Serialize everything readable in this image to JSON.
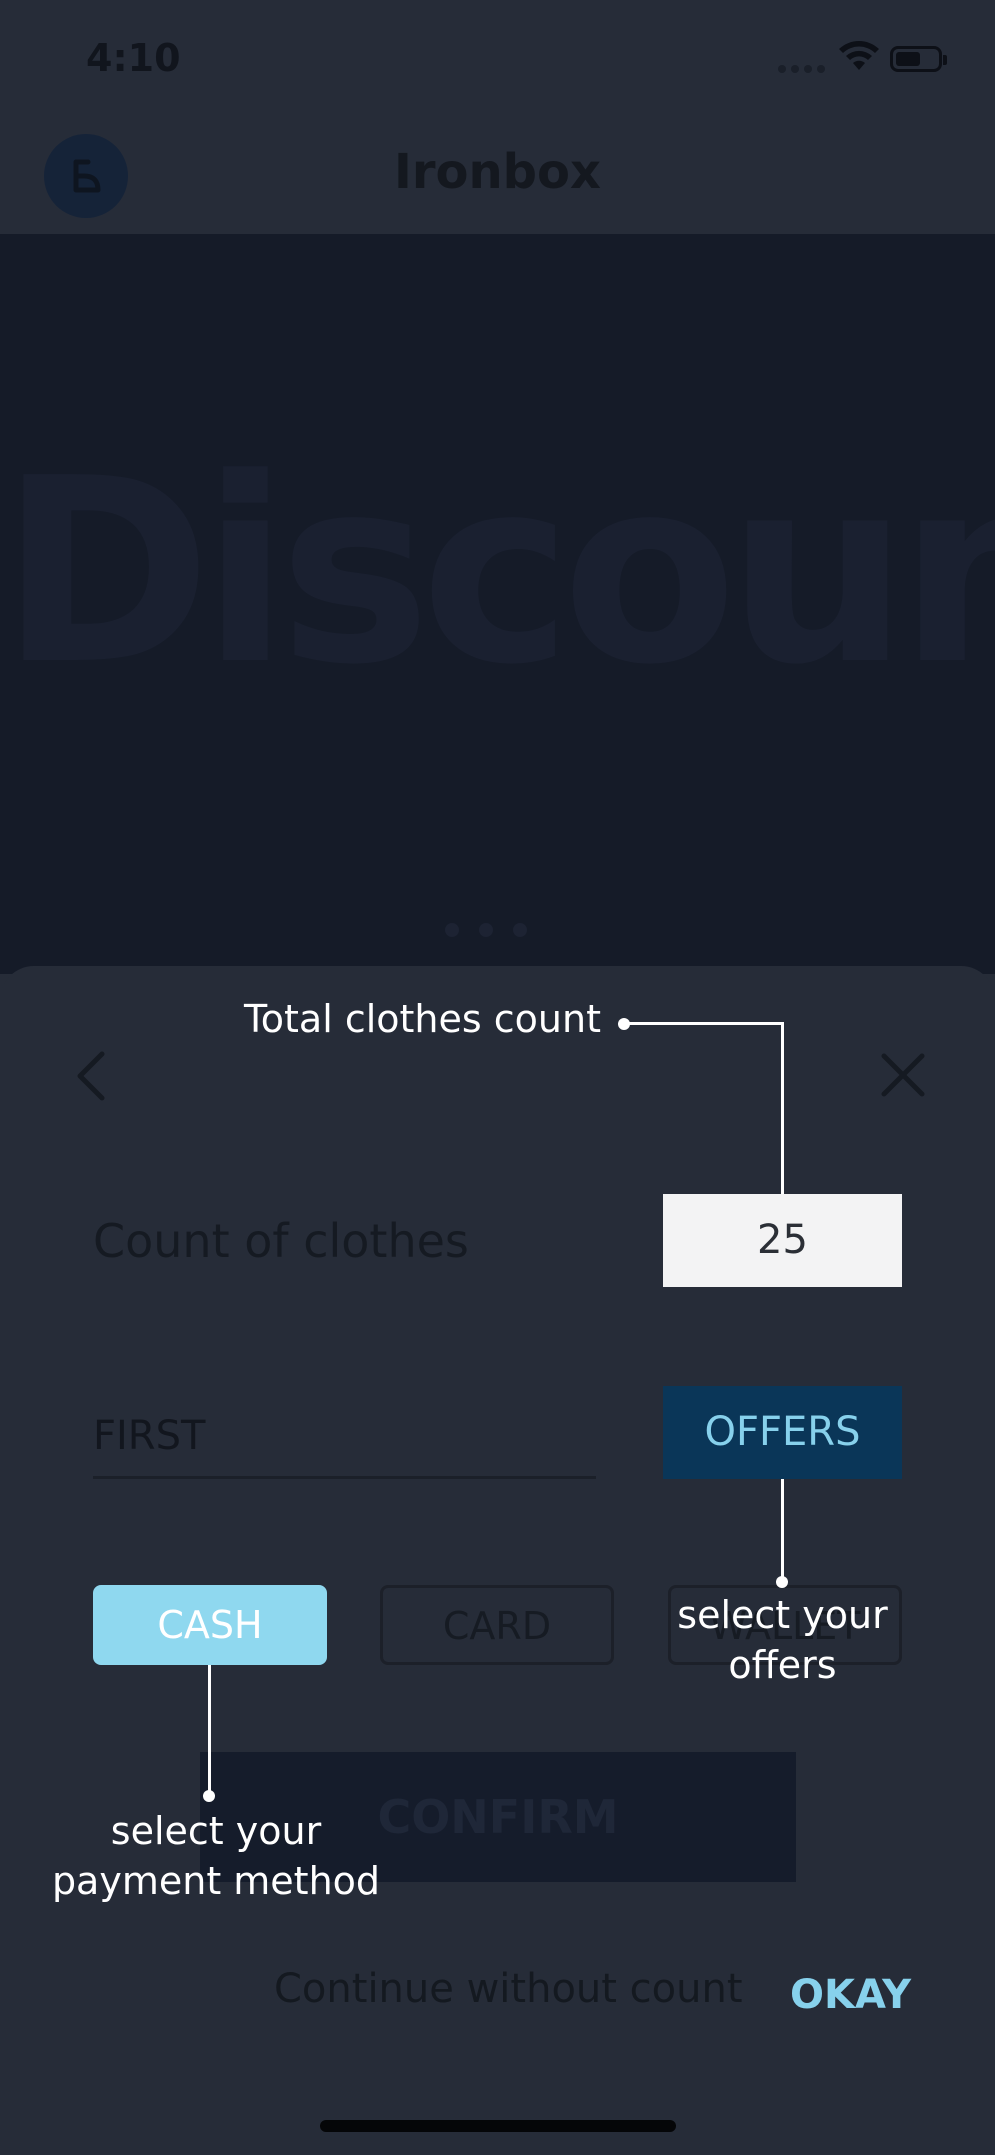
{
  "status_bar": {
    "time": "4:10"
  },
  "header": {
    "title": "Ironbox"
  },
  "banner": {
    "text": "Discount"
  },
  "form": {
    "count_label": "Count of clothes",
    "count_value": "25",
    "promo_value": "FIRST",
    "offers_label": "OFFERS",
    "payment": {
      "cash": "CASH",
      "card": "CARD",
      "wallet": "WALLET"
    },
    "confirm_label": "CONFIRM",
    "continue_label": "Continue without count",
    "okay_label": "OKAY"
  },
  "annotations": {
    "total": "Total clothes count",
    "offers_line1": "select your",
    "offers_line2": "offers",
    "payment_line1": "select your",
    "payment_line2": "payment method"
  },
  "colors": {
    "background": "#262c38",
    "accent": "#87d1ec",
    "offers_bg": "#0a3658",
    "cash_bg": "#8fd8ef"
  }
}
